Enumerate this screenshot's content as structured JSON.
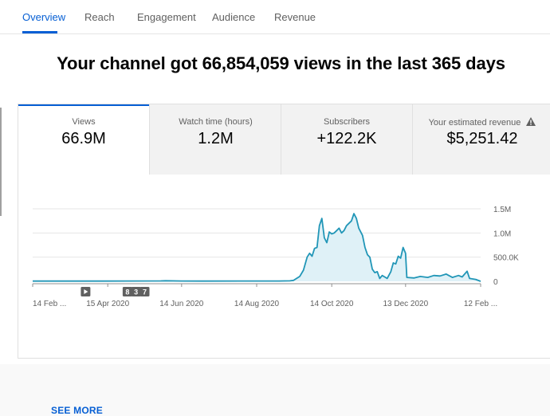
{
  "tabs": [
    {
      "label": "Overview",
      "active": true
    },
    {
      "label": "Reach"
    },
    {
      "label": "Engagement"
    },
    {
      "label": "Audience"
    },
    {
      "label": "Revenue"
    }
  ],
  "headline": "Your channel got 66,854,059 views in the last 365 days",
  "metrics": [
    {
      "label": "Views",
      "value": "66.9M"
    },
    {
      "label": "Watch time (hours)",
      "value": "1.2M"
    },
    {
      "label": "Subscribers",
      "value": "+122.2K"
    },
    {
      "label": "Your estimated revenue",
      "value": "$5,251.42",
      "icon": "warning-icon"
    }
  ],
  "see_more": "SEE MORE",
  "colors": {
    "accent": "#065fd4",
    "series": "#2196b7",
    "area": "#dff1f7"
  },
  "chart_data": {
    "type": "area",
    "title": "",
    "xlabel": "",
    "ylabel": "",
    "ylim": [
      0,
      1500000
    ],
    "yticks": [
      0,
      500000,
      1000000,
      1500000
    ],
    "ytick_labels": [
      "0",
      "500.0K",
      "1.0M",
      "1.5M"
    ],
    "xtick_labels": [
      "14 Feb ...",
      "15 Apr 2020",
      "14 Jun 2020",
      "14 Aug 2020",
      "14 Oct 2020",
      "13 Dec 2020",
      "12 Feb ..."
    ],
    "xtick_dates": [
      "2020-02-14",
      "2020-04-15",
      "2020-06-14",
      "2020-08-14",
      "2020-10-14",
      "2020-12-13",
      "2021-02-12"
    ],
    "grid": true,
    "annotations": [
      {
        "label": "",
        "icon": "play-icon",
        "date": "2020-03-28"
      },
      {
        "label": "8",
        "date": "2020-05-01"
      },
      {
        "label": "3",
        "date": "2020-05-08"
      },
      {
        "label": "7",
        "date": "2020-05-15"
      }
    ],
    "series": [
      {
        "points": [
          [
            "2020-02-14",
            5000
          ],
          [
            "2020-03-01",
            5000
          ],
          [
            "2020-04-01",
            5000
          ],
          [
            "2020-05-01",
            6000
          ],
          [
            "2020-05-28",
            8000
          ],
          [
            "2020-06-01",
            12000
          ],
          [
            "2020-06-14",
            6000
          ],
          [
            "2020-07-01",
            5000
          ],
          [
            "2020-08-01",
            6000
          ],
          [
            "2020-09-01",
            7000
          ],
          [
            "2020-09-10",
            10000
          ],
          [
            "2020-09-13",
            20000
          ],
          [
            "2020-09-18",
            100000
          ],
          [
            "2020-09-21",
            230000
          ],
          [
            "2020-09-24",
            500000
          ],
          [
            "2020-09-26",
            580000
          ],
          [
            "2020-09-28",
            520000
          ],
          [
            "2020-09-30",
            680000
          ],
          [
            "2020-10-02",
            700000
          ],
          [
            "2020-10-04",
            1150000
          ],
          [
            "2020-10-06",
            1300000
          ],
          [
            "2020-10-08",
            900000
          ],
          [
            "2020-10-10",
            800000
          ],
          [
            "2020-10-12",
            1020000
          ],
          [
            "2020-10-14",
            980000
          ],
          [
            "2020-10-16",
            1000000
          ],
          [
            "2020-10-18",
            1050000
          ],
          [
            "2020-10-20",
            1100000
          ],
          [
            "2020-10-22",
            1000000
          ],
          [
            "2020-10-24",
            1050000
          ],
          [
            "2020-10-26",
            1150000
          ],
          [
            "2020-10-28",
            1200000
          ],
          [
            "2020-10-30",
            1250000
          ],
          [
            "2020-11-01",
            1400000
          ],
          [
            "2020-11-03",
            1300000
          ],
          [
            "2020-11-05",
            1100000
          ],
          [
            "2020-11-08",
            950000
          ],
          [
            "2020-11-10",
            700000
          ],
          [
            "2020-11-12",
            550000
          ],
          [
            "2020-11-14",
            500000
          ],
          [
            "2020-11-16",
            250000
          ],
          [
            "2020-11-18",
            180000
          ],
          [
            "2020-11-20",
            200000
          ],
          [
            "2020-11-22",
            60000
          ],
          [
            "2020-11-24",
            120000
          ],
          [
            "2020-11-26",
            90000
          ],
          [
            "2020-11-28",
            60000
          ],
          [
            "2020-12-01",
            200000
          ],
          [
            "2020-12-03",
            380000
          ],
          [
            "2020-12-05",
            360000
          ],
          [
            "2020-12-07",
            520000
          ],
          [
            "2020-12-09",
            480000
          ],
          [
            "2020-12-11",
            700000
          ],
          [
            "2020-12-13",
            580000
          ],
          [
            "2020-12-14",
            80000
          ],
          [
            "2020-12-20",
            70000
          ],
          [
            "2020-12-25",
            100000
          ],
          [
            "2020-12-31",
            80000
          ],
          [
            "2021-01-05",
            120000
          ],
          [
            "2021-01-10",
            110000
          ],
          [
            "2021-01-15",
            150000
          ],
          [
            "2021-01-20",
            80000
          ],
          [
            "2021-01-25",
            120000
          ],
          [
            "2021-01-28",
            90000
          ],
          [
            "2021-02-01",
            210000
          ],
          [
            "2021-02-03",
            60000
          ],
          [
            "2021-02-08",
            40000
          ],
          [
            "2021-02-12",
            0
          ]
        ]
      }
    ]
  }
}
